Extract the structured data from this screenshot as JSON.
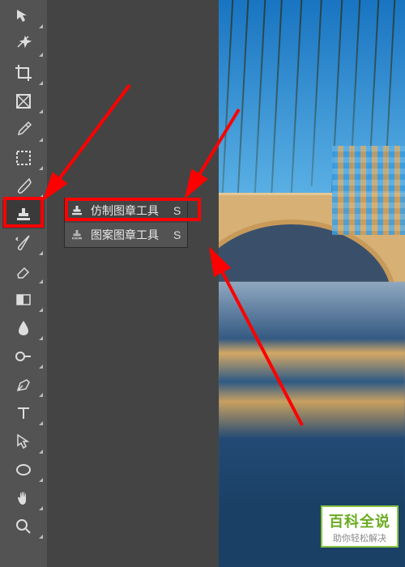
{
  "toolbar": {
    "tools": [
      {
        "name": "move-tool"
      },
      {
        "name": "marquee-tool"
      },
      {
        "name": "lasso-tool"
      },
      {
        "name": "magic-wand-tool"
      },
      {
        "name": "crop-tool"
      },
      {
        "name": "frame-tool"
      },
      {
        "name": "eyedropper-tool"
      },
      {
        "name": "spot-healing-tool"
      },
      {
        "name": "brush-tool"
      },
      {
        "name": "stamp-tool"
      },
      {
        "name": "history-brush-tool"
      },
      {
        "name": "eraser-tool"
      },
      {
        "name": "gradient-tool"
      },
      {
        "name": "blur-tool"
      },
      {
        "name": "dodge-tool"
      },
      {
        "name": "pen-tool"
      },
      {
        "name": "type-tool"
      },
      {
        "name": "path-selection-tool"
      },
      {
        "name": "shape-tool"
      },
      {
        "name": "hand-tool"
      },
      {
        "name": "zoom-tool"
      }
    ]
  },
  "flyout": {
    "items": [
      {
        "label": "仿制图章工具",
        "shortcut": "S",
        "icon": "clone-stamp-icon"
      },
      {
        "label": "图案图章工具",
        "shortcut": "S",
        "icon": "pattern-stamp-icon"
      }
    ]
  },
  "watermark": {
    "title": "百科全说",
    "subtitle": "助你轻松解决"
  },
  "annotations": {
    "highlight_color": "#ff0000",
    "arrow_color": "#ff0000"
  }
}
